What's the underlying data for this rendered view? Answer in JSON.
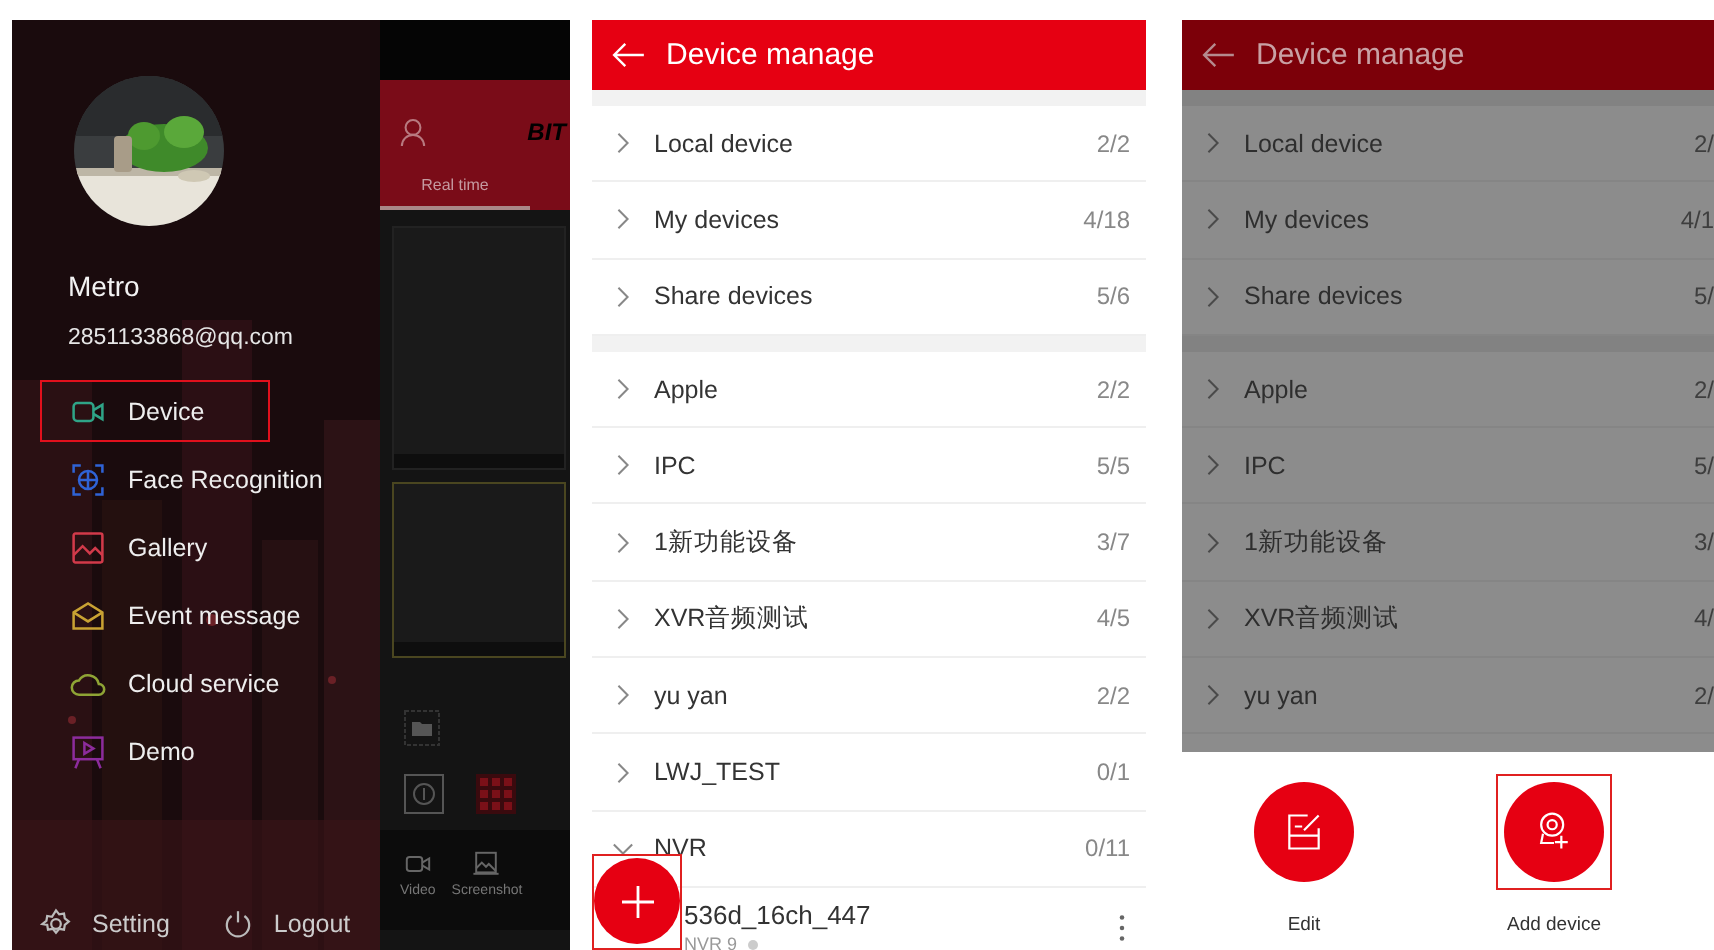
{
  "drawer_screen": {
    "user": {
      "name": "Metro",
      "email": "2851133868@qq.com"
    },
    "menu": [
      {
        "label": "Device",
        "kind": "camera",
        "highlighted": true
      },
      {
        "label": "Face Recognition",
        "kind": "face",
        "highlighted": false
      },
      {
        "label": "Gallery",
        "kind": "gallery",
        "highlighted": false
      },
      {
        "label": "Event message",
        "kind": "message",
        "highlighted": false
      },
      {
        "label": "Cloud service",
        "kind": "cloud",
        "highlighted": false
      },
      {
        "label": "Demo",
        "kind": "demo",
        "highlighted": false
      }
    ],
    "footer": [
      {
        "label": "Setting",
        "kind": "settings"
      },
      {
        "label": "Logout",
        "kind": "logout"
      }
    ],
    "background_app": {
      "logo": "BIT",
      "tabs": [
        {
          "label": "Real time",
          "selected": true
        }
      ],
      "actions": [
        {
          "label": "Video",
          "kind": "video"
        },
        {
          "label": "Screenshot",
          "kind": "screenshot"
        }
      ]
    }
  },
  "device_screen": {
    "title": "Device manage",
    "groups": [
      {
        "items": [
          {
            "name": "Local device",
            "count": "2/2",
            "expanded": false
          },
          {
            "name": "My devices",
            "count": "4/18",
            "expanded": false
          },
          {
            "name": "Share devices",
            "count": "5/6",
            "expanded": false
          }
        ]
      },
      {
        "items": [
          {
            "name": "Apple",
            "count": "2/2",
            "expanded": false
          },
          {
            "name": "IPC",
            "count": "5/5",
            "expanded": false
          },
          {
            "name": "1新功能设备",
            "count": "3/7",
            "expanded": false
          },
          {
            "name": "XVR音频测试",
            "count": "4/5",
            "expanded": false
          },
          {
            "name": "yu yan",
            "count": "2/2",
            "expanded": false
          },
          {
            "name": "LWJ_TEST",
            "count": "0/1",
            "expanded": false
          },
          {
            "name": "NVR",
            "count": "0/11",
            "expanded": true,
            "children": [
              {
                "name": "536d_16ch_447",
                "subtitle": "NVR 9",
                "online": false
              }
            ]
          }
        ]
      }
    ],
    "fab": {
      "highlighted": true
    }
  },
  "device_screen_with_menu": {
    "title": "Device manage",
    "groups": [
      {
        "items": [
          {
            "name": "Local device",
            "count": "2/",
            "expanded": false
          },
          {
            "name": "My devices",
            "count": "4/1",
            "expanded": false
          },
          {
            "name": "Share devices",
            "count": "5/",
            "expanded": false
          }
        ]
      },
      {
        "items": [
          {
            "name": "Apple",
            "count": "2/",
            "expanded": false
          },
          {
            "name": "IPC",
            "count": "5/",
            "expanded": false
          },
          {
            "name": "1新功能设备",
            "count": "3/",
            "expanded": false
          },
          {
            "name": "XVR音频测试",
            "count": "4/",
            "expanded": false
          },
          {
            "name": "yu yan",
            "count": "2/",
            "expanded": false
          }
        ]
      }
    ],
    "actions": [
      {
        "label": "Edit",
        "kind": "edit",
        "highlighted": false
      },
      {
        "label": "Add device",
        "kind": "add",
        "highlighted": true
      }
    ]
  }
}
